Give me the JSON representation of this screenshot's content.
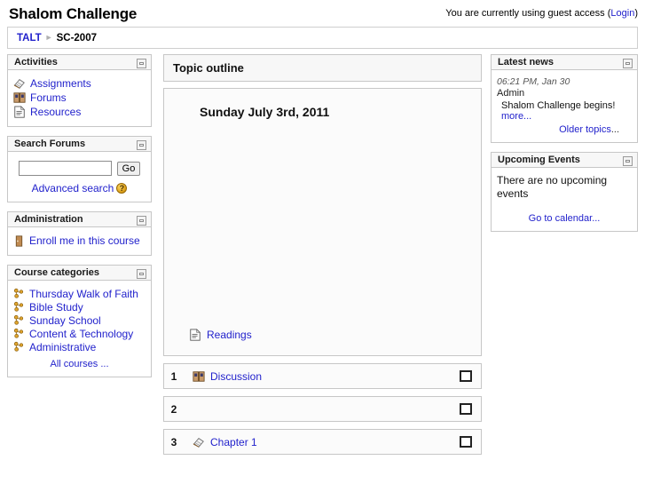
{
  "header": {
    "site_title": "Shalom Challenge",
    "guest_text": "You are currently using guest access",
    "login_open": "(",
    "login_label": "Login",
    "login_close": ")"
  },
  "breadcrumb": {
    "root": "TALT",
    "separator": "►",
    "current": "SC-2007"
  },
  "blocks": {
    "activities": {
      "title": "Activities",
      "collapse_label": "-",
      "items": [
        {
          "label": "Assignments",
          "icon": "assignment-icon"
        },
        {
          "label": "Forums",
          "icon": "forum-icon"
        },
        {
          "label": "Resources",
          "icon": "resource-icon"
        }
      ]
    },
    "search_forums": {
      "title": "Search Forums",
      "collapse_label": "-",
      "input_value": "",
      "input_placeholder": "",
      "go_label": "Go",
      "advanced_label": "Advanced search",
      "help_label": "?"
    },
    "administration": {
      "title": "Administration",
      "collapse_label": "-",
      "enroll_label": "Enroll me in this course",
      "enroll_icon": "enrol-user-icon"
    },
    "course_categories": {
      "title": "Course categories",
      "collapse_label": "-",
      "items": [
        {
          "label": "Thursday Walk of Faith"
        },
        {
          "label": "Bible Study"
        },
        {
          "label": "Sunday School"
        },
        {
          "label": "Content & Technology"
        },
        {
          "label": "Administrative"
        }
      ],
      "all_courses_label": "All courses ..."
    },
    "latest_news": {
      "title": "Latest news",
      "collapse_label": "-",
      "date": "06:21 PM, Jan 30",
      "author": "Admin",
      "subject": "Shalom Challenge begins!",
      "more_label": "more...",
      "older_label": "Older topics",
      "older_suffix": "..."
    },
    "upcoming_events": {
      "title": "Upcoming Events",
      "collapse_label": "-",
      "empty_text": "There are no upcoming events",
      "calendar_label": "Go to calendar..."
    }
  },
  "main": {
    "outline_title": "Topic outline",
    "topic0": {
      "title": "Sunday July 3rd, 2011",
      "resource_label": "Readings",
      "resource_icon": "resource-icon"
    },
    "topics": [
      {
        "number": "1",
        "label": "Discussion",
        "icon": "forum-icon",
        "highlight": "highlight-topic-button"
      },
      {
        "number": "2",
        "label": "",
        "icon": "",
        "highlight": "highlight-topic-button"
      },
      {
        "number": "3",
        "label": "Chapter 1",
        "icon": "assignment-icon",
        "highlight": "highlight-topic-button"
      }
    ]
  },
  "colors": {
    "link": "#2222cc",
    "border": "#c7c7c7",
    "block_header_bg": "#f7f7f7",
    "body_bg": "#ffffff"
  }
}
